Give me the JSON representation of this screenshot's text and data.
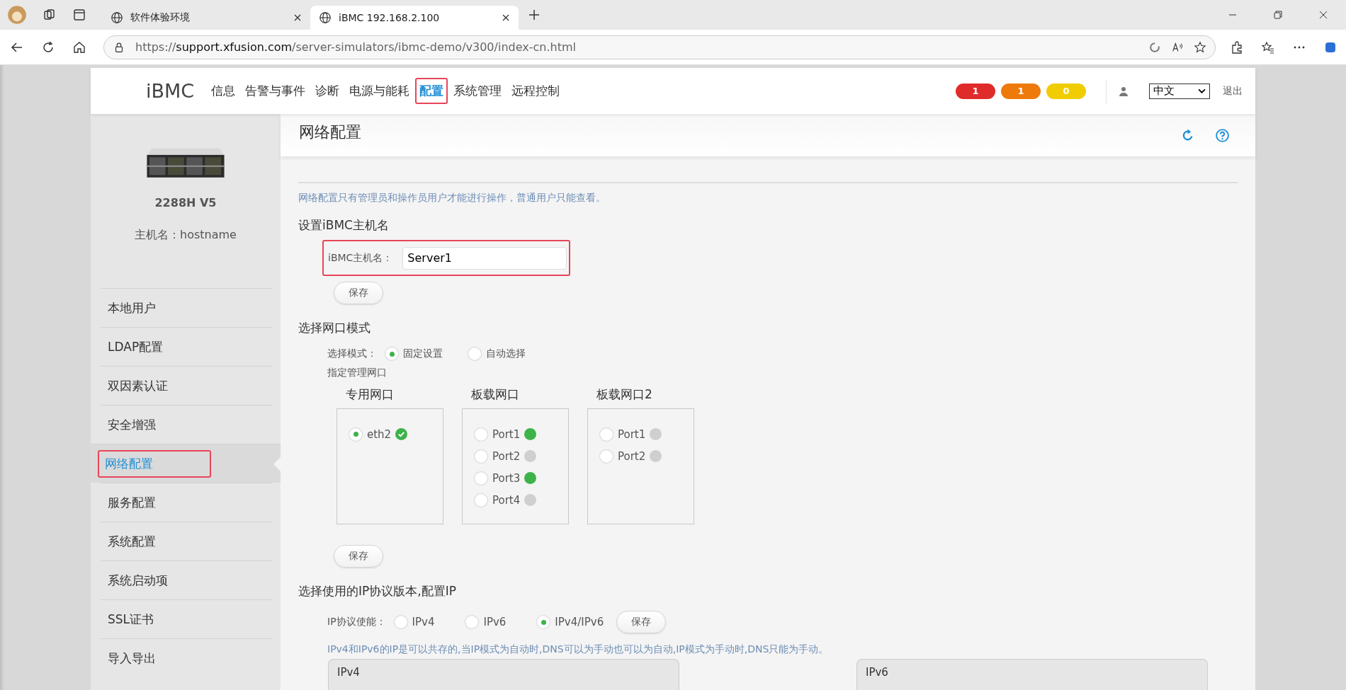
{
  "browser": {
    "tabs": [
      {
        "title": "软件体验环境",
        "selected": false
      },
      {
        "title": "iBMC 192.168.2.100",
        "selected": true
      }
    ],
    "url_scheme": "https://",
    "url_host": "support.xfusion.com",
    "url_path": "/server-simulators/ibmc-demo/v300/index-cn.html"
  },
  "header": {
    "logo": "iBMC",
    "nav": [
      {
        "label": "信息",
        "selected": false,
        "highlighted": false
      },
      {
        "label": "告警与事件",
        "selected": false,
        "highlighted": false
      },
      {
        "label": "诊断",
        "selected": false,
        "highlighted": false
      },
      {
        "label": "电源与能耗",
        "selected": false,
        "highlighted": false
      },
      {
        "label": "配置",
        "selected": true,
        "highlighted": true
      },
      {
        "label": "系统管理",
        "selected": false,
        "highlighted": false
      },
      {
        "label": "远程控制",
        "selected": false,
        "highlighted": false
      }
    ],
    "alarms": [
      {
        "count": "1",
        "color": "#e02b2b"
      },
      {
        "count": "1",
        "color": "#ee7a0c"
      },
      {
        "count": "0",
        "color": "#f0cc00"
      }
    ],
    "language": "中文",
    "logout": "退出"
  },
  "sidebar": {
    "model": "2288H V5",
    "hostname": "主机名：hostname",
    "items": [
      {
        "label": "本地用户",
        "selected": false,
        "highlighted": false
      },
      {
        "label": "LDAP配置",
        "selected": false,
        "highlighted": false
      },
      {
        "label": "双因素认证",
        "selected": false,
        "highlighted": false
      },
      {
        "label": "安全增强",
        "selected": false,
        "highlighted": false
      },
      {
        "label": "网络配置",
        "selected": true,
        "highlighted": true
      },
      {
        "label": "服务配置",
        "selected": false,
        "highlighted": false
      },
      {
        "label": "系统配置",
        "selected": false,
        "highlighted": false
      },
      {
        "label": "系统启动项",
        "selected": false,
        "highlighted": false
      },
      {
        "label": "SSL证书",
        "selected": false,
        "highlighted": false
      },
      {
        "label": "导入导出",
        "selected": false,
        "highlighted": false
      }
    ]
  },
  "page": {
    "title": "网络配置",
    "notice": "网络配置只有管理员和操作员用户才能进行操作，普通用户只能查看。",
    "hostname_section": {
      "heading": "设置iBMC主机名",
      "label": "iBMC主机名：",
      "value": "Server1",
      "highlighted": true,
      "save": "保存"
    },
    "port_section": {
      "heading": "选择网口模式",
      "mode_label": "选择模式：",
      "modes": [
        {
          "label": "固定设置",
          "selected": true
        },
        {
          "label": "自动选择",
          "selected": false
        }
      ],
      "assign_label": "指定管理网口",
      "groups": [
        {
          "title": "专用网口",
          "ports": [
            {
              "label": "eth2",
              "selected": true,
              "kind": "check",
              "link_up": true
            }
          ]
        },
        {
          "title": "板载网口",
          "ports": [
            {
              "label": "Port1",
              "selected": false,
              "kind": "dot",
              "link_up": true
            },
            {
              "label": "Port2",
              "selected": false,
              "kind": "dot",
              "link_up": false
            },
            {
              "label": "Port3",
              "selected": false,
              "kind": "dot",
              "link_up": true
            },
            {
              "label": "Port4",
              "selected": false,
              "kind": "dot",
              "link_up": false
            }
          ]
        },
        {
          "title": "板载网口2",
          "ports": [
            {
              "label": "Port1",
              "selected": false,
              "kind": "dot",
              "link_up": false
            },
            {
              "label": "Port2",
              "selected": false,
              "kind": "dot",
              "link_up": false
            }
          ]
        }
      ],
      "save": "保存"
    },
    "ip_section": {
      "heading": "选择使用的IP协议版本,配置IP",
      "label": "IP协议使能：",
      "options": [
        {
          "label": "IPv4",
          "selected": false
        },
        {
          "label": "IPv6",
          "selected": false
        },
        {
          "label": "IPv4/IPv6",
          "selected": true
        }
      ],
      "save": "保存",
      "note": "IPv4和IPv6的IP是可以共存的,当IP模式为自动时,DNS可以为手动也可以为自动,IP模式为手动时,DNS只能为手动。",
      "panels": [
        "IPv4",
        "IPv6"
      ]
    }
  }
}
